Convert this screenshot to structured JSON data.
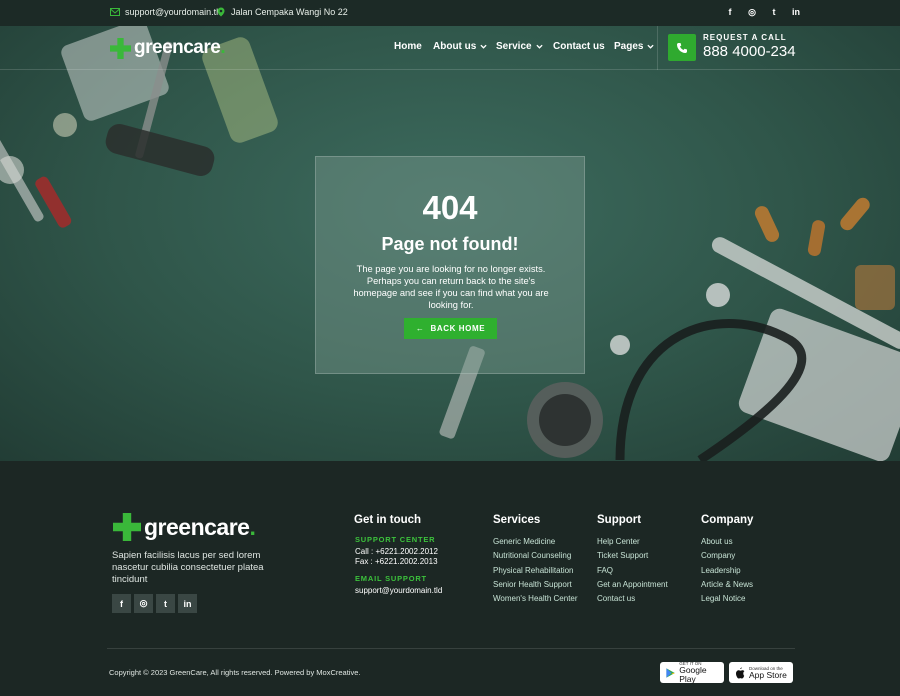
{
  "topbar": {
    "email": "support@yourdomain.tld",
    "address": "Jalan Cempaka Wangi No 22",
    "social": [
      "f",
      "◎",
      "t",
      "in"
    ]
  },
  "brand": {
    "name": "greencare",
    "dot": "."
  },
  "nav": {
    "items": [
      {
        "label": "Home",
        "dropdown": false
      },
      {
        "label": "About us",
        "dropdown": true
      },
      {
        "label": "Service",
        "dropdown": true
      },
      {
        "label": "Contact us",
        "dropdown": false
      },
      {
        "label": "Pages",
        "dropdown": true
      }
    ],
    "request_label": "REQUEST A CALL",
    "phone": "888 4000-234"
  },
  "error": {
    "code": "404",
    "title": "Page not found!",
    "message": "The page you are looking for no longer exists. Perhaps you can return back to the site's homepage and see if you can find what you are looking for.",
    "button_label": "BACK HOME",
    "button_arrow": "←"
  },
  "footer": {
    "description": "Sapien facilisis lacus per sed lorem nascetur cubilia consectetuer platea tincidunt",
    "social": [
      "f",
      "◎",
      "t",
      "in"
    ],
    "get_in_touch": {
      "heading": "Get in touch",
      "support_center_label": "SUPPORT CENTER",
      "call": "Call : +6221.2002.2012",
      "fax": "Fax : +6221.2002.2013",
      "email_support_label": "EMAIL SUPPORT",
      "email": "support@yourdomain.tld"
    },
    "services": {
      "heading": "Services",
      "links": [
        "Generic Medicine",
        "Nutritional Counseling",
        "Physical Rehabilitation",
        "Senior Health Support",
        "Women's Health Center"
      ]
    },
    "support": {
      "heading": "Support",
      "links": [
        "Help Center",
        "Ticket Support",
        "FAQ",
        "Get an Appointment",
        "Contact us"
      ]
    },
    "company": {
      "heading": "Company",
      "links": [
        "About us",
        "Company",
        "Leadership",
        "Article & News",
        "Legal Notice"
      ]
    },
    "copyright": "Copyright © 2023 GreenCare, All rights reserved. Powered by MoxCreative.",
    "google_play": {
      "small": "GET IT ON",
      "big": "Google Play"
    },
    "app_store": {
      "small": "Download on the",
      "big": "App Store"
    }
  },
  "colors": {
    "accent": "#2faa2f",
    "dark": "#1c2724",
    "hero": "#2f5549"
  }
}
